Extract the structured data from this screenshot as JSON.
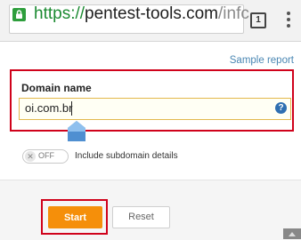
{
  "browser": {
    "url": {
      "scheme": "https://",
      "host": "pentest-tools.com",
      "path": "/infc"
    },
    "tab_count": "1",
    "icons": [
      "lock-icon",
      "tabs-icon",
      "overflow-menu-icon"
    ]
  },
  "page": {
    "sample_report_label": "Sample report",
    "domain_label": "Domain name",
    "domain_value": "oi.com.br",
    "help_icon": "?",
    "subdomain_toggle": {
      "state_label": "OFF",
      "off_symbol": "✕"
    },
    "subdomain_label": "Include subdomain details",
    "start_label": "Start",
    "reset_label": "Reset"
  },
  "colors": {
    "https_green": "#1b8a31",
    "highlight_red": "#d0021b",
    "start_orange": "#f58f0a",
    "link_blue": "#4a87b3"
  }
}
